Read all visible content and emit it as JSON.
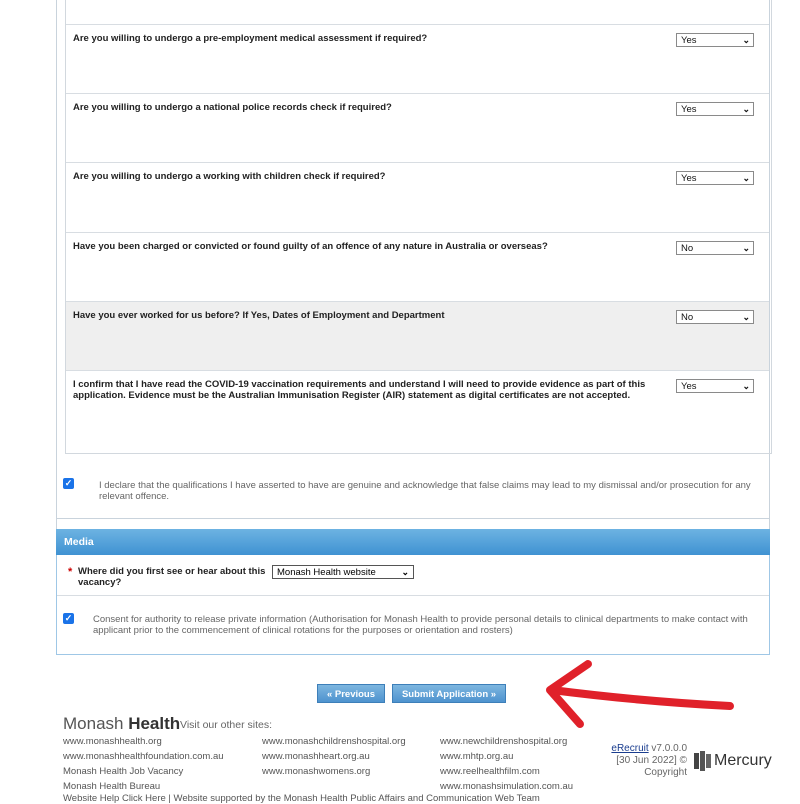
{
  "questions": [
    {
      "text": "Are you willing to undergo a pre-employment medical assessment if required?",
      "answer": "Yes"
    },
    {
      "text": "Are you willing to undergo a national police records check if required?",
      "answer": "Yes"
    },
    {
      "text": "Are you willing to undergo a working with children check if required?",
      "answer": "Yes"
    },
    {
      "text": "Have you been charged or convicted or found guilty of an offence of any nature in Australia or overseas?",
      "answer": "No"
    },
    {
      "text": "Have you ever worked for us before? If Yes, Dates of Employment and Department",
      "answer": "No"
    },
    {
      "text": "I confirm that I have read the COVID-19 vaccination requirements and understand I will need to provide evidence as part of this application. Evidence must be the Australian Immunisation Register (AIR) statement as digital certificates are not accepted.",
      "answer": "Yes"
    }
  ],
  "declaration": "I declare that the qualifications I have asserted to have are genuine and acknowledge that false claims may lead to my dismissal and/or prosecution for any relevant offence.",
  "media": {
    "title": "Media",
    "required_marker": "*",
    "question": "Where did you first see or hear about this vacancy?",
    "answer": "Monash Health website",
    "consent": "Consent for authority to release private information (Authorisation for Monash Health to provide personal details to clinical departments to make contact with applicant prior to the commencement of clinical rotations for the purposes or orientation and rosters)"
  },
  "buttons": {
    "previous": "« Previous",
    "submit": "Submit Application »"
  },
  "footer": {
    "logo_light": "Monash ",
    "logo_bold": "Health",
    "visit": "Visit our other sites:",
    "col1": [
      "www.monashhealth.org",
      "www.monashhealthfoundation.com.au",
      "Monash Health Job Vacancy",
      "Monash Health Bureau"
    ],
    "col2": [
      "www.monashchildrenshospital.org",
      "www.monashheart.org.au",
      "www.monashwomens.org"
    ],
    "col3": [
      "www.newchildrenshospital.org",
      "www.mhtp.org.au",
      "www.reelhealthfilm.com",
      "www.monashsimulation.com.au"
    ],
    "bottom_line": "Website Help Click Here | Website supported by the Monash Health Public Affairs and Communication Web Team",
    "erecruit_link": "eRecruit",
    "erecruit_version": " v7.0.0.0",
    "erecruit_date": "[30 Jun 2022] ©",
    "copyright": "Copyright",
    "mercury": "Mercury"
  },
  "colors": {
    "accent": "#4e93cf",
    "arrow": "#e0212a",
    "checkbox": "#1a73e8"
  }
}
